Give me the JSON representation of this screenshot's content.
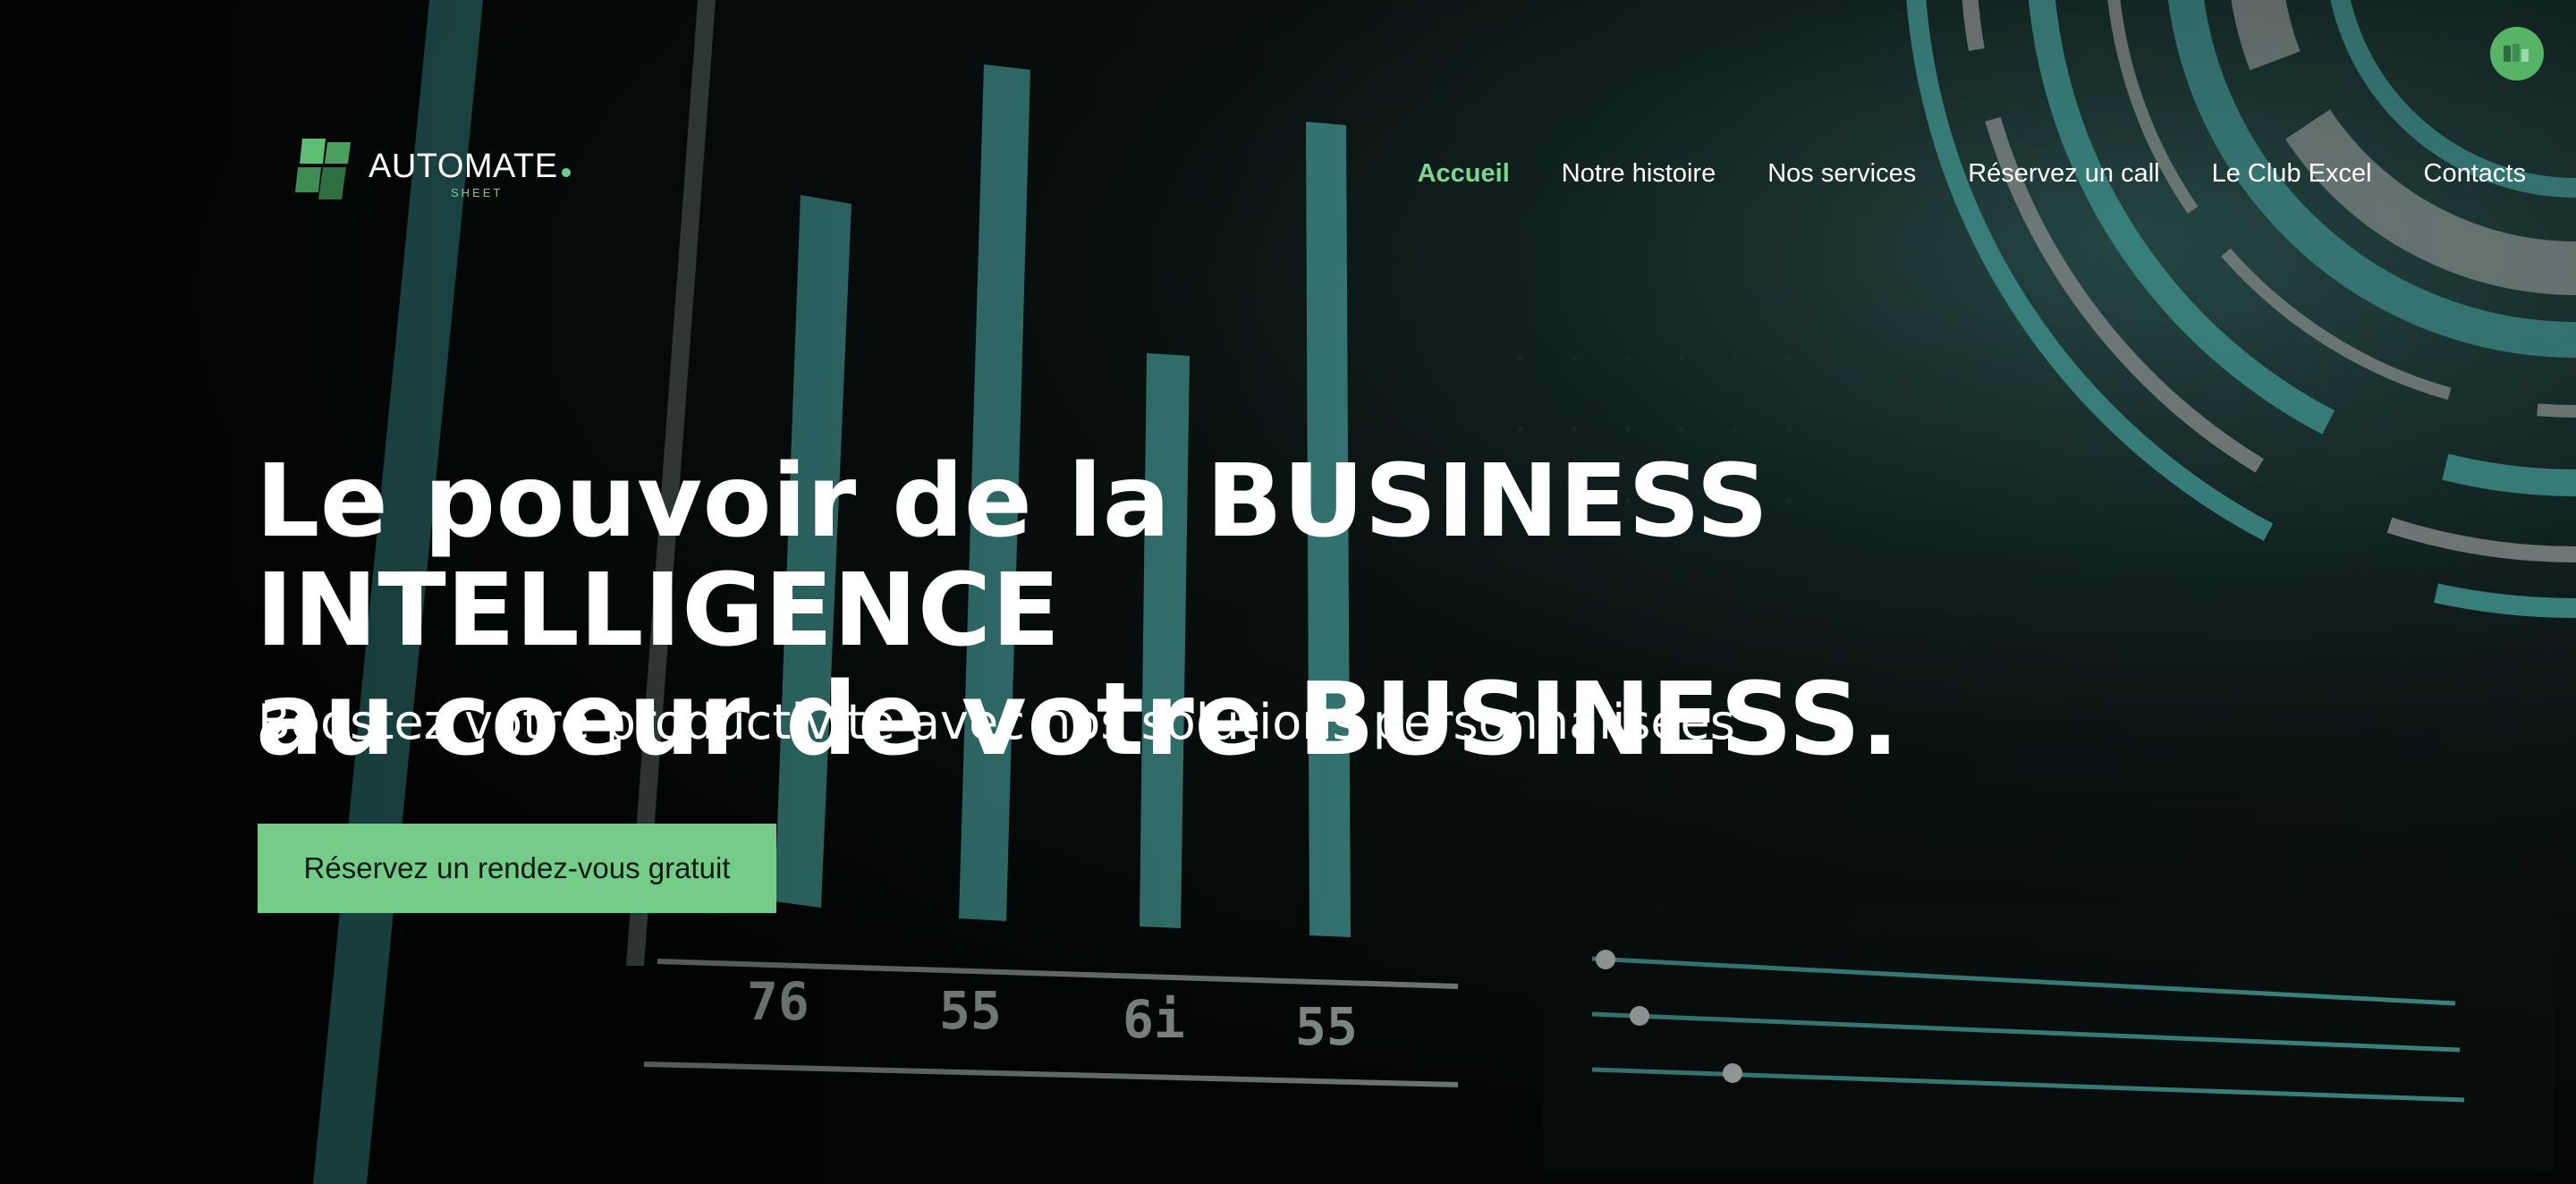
{
  "brand": {
    "name": "AUTOMATE",
    "subtitle": "SHEET",
    "accent_color": "#74cc88"
  },
  "nav": {
    "items": [
      {
        "label": "Accueil",
        "active": true
      },
      {
        "label": "Notre histoire",
        "active": false
      },
      {
        "label": "Nos services",
        "active": false
      },
      {
        "label": "Réservez un call",
        "active": false
      },
      {
        "label": "Le Club Excel",
        "active": false
      },
      {
        "label": "Contacts",
        "active": false
      }
    ]
  },
  "hero": {
    "headline_line1": "Le pouvoir de la BUSINESS INTELLIGENCE",
    "headline_line2": "au coeur de votre BUSINESS.",
    "subheadline": "Boostez votre productivité avec nos solutions personnalisées",
    "cta_label": "Réservez un rendez-vous gratuit",
    "background_numbers": [
      "76",
      "55",
      "6i",
      "55"
    ]
  },
  "colors": {
    "teal": "#4fb3ad",
    "dark": "#050807",
    "nav_active": "#7dd68f"
  }
}
